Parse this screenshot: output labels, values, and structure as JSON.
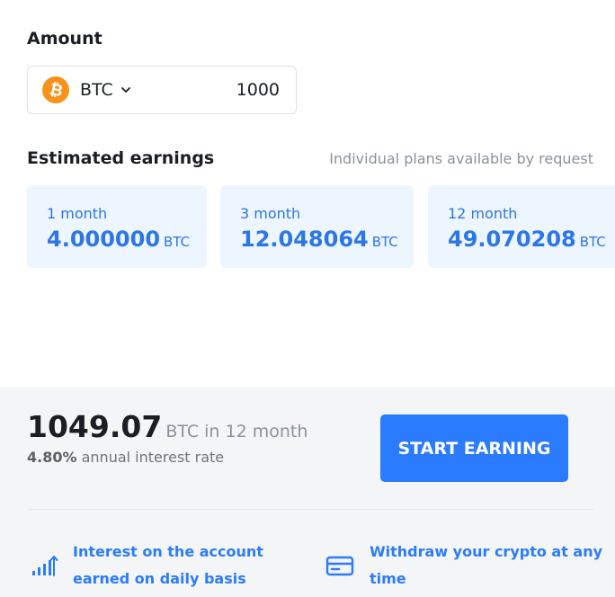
{
  "amount": {
    "label": "Amount",
    "currency": "BTC",
    "value": "1000",
    "coin_color": "#f7931a"
  },
  "estimates": {
    "label": "Estimated earnings",
    "note": "Individual plans available by request",
    "cards": [
      {
        "period": "1 month",
        "value": "4.000000",
        "unit": "BTC"
      },
      {
        "period": "3 month",
        "value": "12.048064",
        "unit": "BTC"
      },
      {
        "period": "12 month",
        "value": "49.070208",
        "unit": "BTC"
      }
    ]
  },
  "summary": {
    "total": "1049.07",
    "total_suffix": "BTC in 12 month",
    "rate": "4.80%",
    "rate_suffix": "annual interest rate",
    "cta": "START EARNING"
  },
  "features": [
    {
      "icon": "bar-chart-up-icon",
      "line1": "Interest on the account",
      "line2": "earned on daily basis"
    },
    {
      "icon": "credit-card-icon",
      "line1": "Withdraw your crypto at any",
      "line2": "time"
    }
  ],
  "colors": {
    "accent": "#2b7bff",
    "card_bg": "#edf5ff",
    "card_text": "#2c76e6",
    "bottom_bg": "#f4f5f7"
  }
}
